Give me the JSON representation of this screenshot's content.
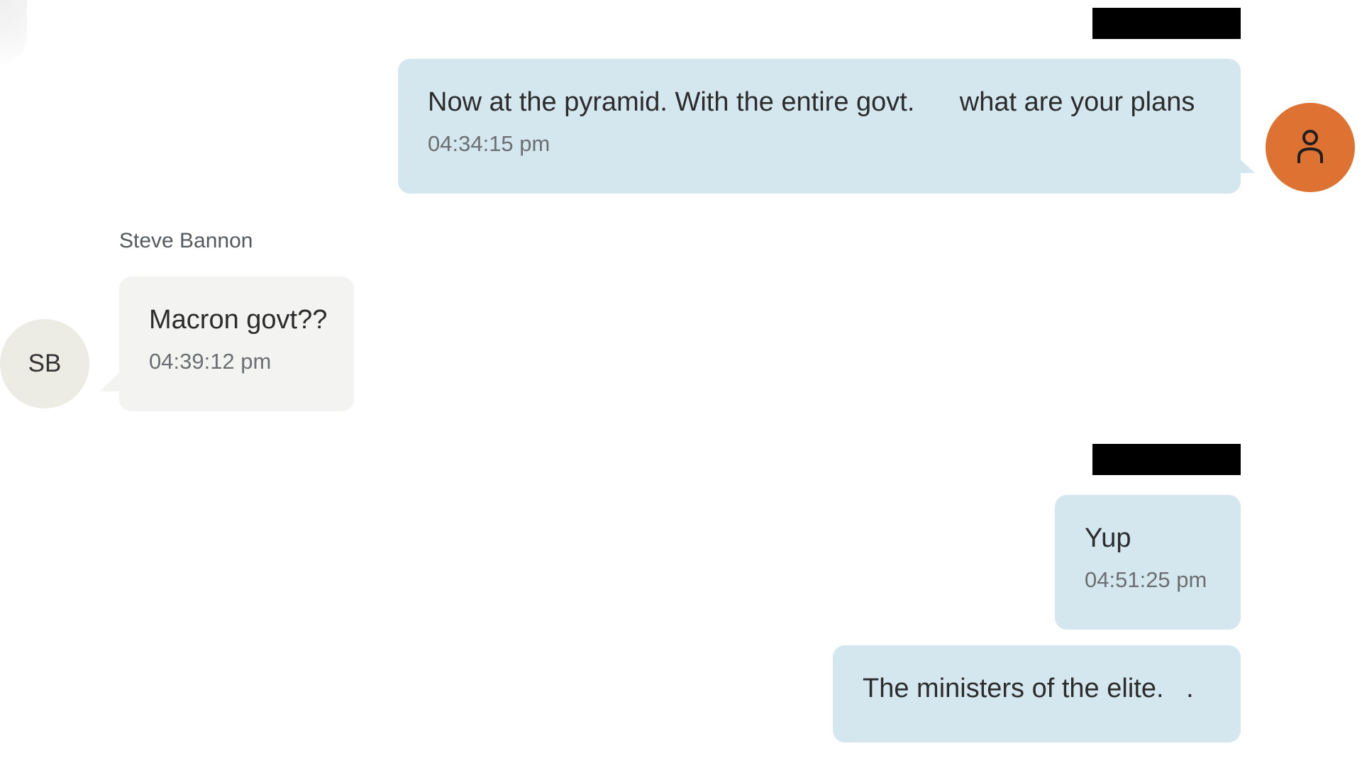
{
  "messages": [
    {
      "direction": "outgoing",
      "text": "Now at the pyramid. With the entire govt.      what are your plans",
      "time": "04:34:15 pm"
    },
    {
      "direction": "incoming",
      "sender": "Steve Bannon",
      "sender_initials": "SB",
      "text": "Macron govt??",
      "time": "04:39:12 pm"
    },
    {
      "direction": "outgoing",
      "text": "Yup",
      "time": "04:51:25 pm"
    },
    {
      "direction": "outgoing",
      "text": "The ministers of the elite.   ."
    }
  ],
  "icons": {
    "own_avatar": "user-icon"
  },
  "colors": {
    "outgoing_bubble": "#d4e7ef",
    "incoming_bubble": "#f3f3f2",
    "own_avatar": "#dd7233",
    "sender_avatar": "#ecece4",
    "redaction": "#000000"
  }
}
